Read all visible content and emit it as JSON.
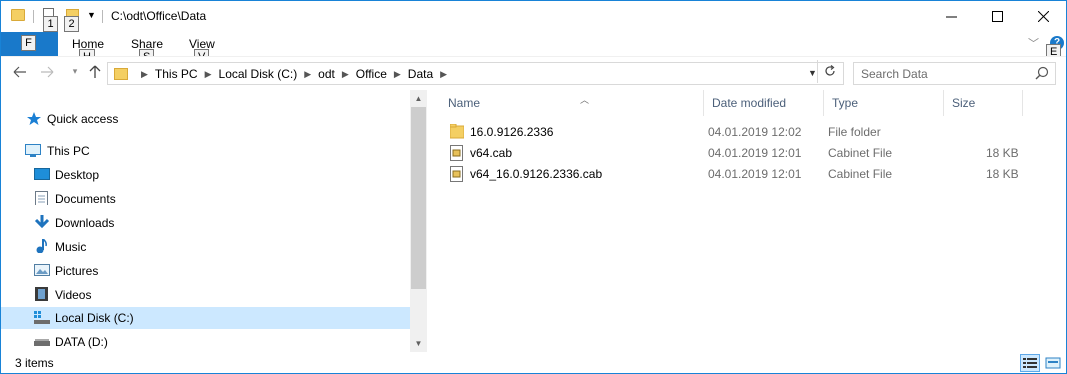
{
  "window": {
    "title": "C:\\odt\\Office\\Data",
    "keytips": {
      "qat1": "1",
      "qat2": "2",
      "file": "F",
      "home": "H",
      "share": "S",
      "view": "V",
      "help": "E"
    }
  },
  "ribbon": {
    "tabs": [
      "Home",
      "Share",
      "View"
    ],
    "help_glyph": "?"
  },
  "address": {
    "crumbs": [
      "This PC",
      "Local Disk (C:)",
      "odt",
      "Office",
      "Data"
    ]
  },
  "search": {
    "placeholder": "Search Data"
  },
  "navpane": {
    "items": [
      {
        "label": "Quick access",
        "icon": "star-icon"
      },
      {
        "label": "This PC",
        "icon": "computer-icon"
      },
      {
        "label": "Desktop",
        "icon": "desktop-icon"
      },
      {
        "label": "Documents",
        "icon": "documents-icon"
      },
      {
        "label": "Downloads",
        "icon": "downloads-icon"
      },
      {
        "label": "Music",
        "icon": "music-icon"
      },
      {
        "label": "Pictures",
        "icon": "pictures-icon"
      },
      {
        "label": "Videos",
        "icon": "videos-icon"
      },
      {
        "label": "Local Disk (C:)",
        "icon": "drive-icon",
        "selected": true
      },
      {
        "label": "DATA (D:)",
        "icon": "drive-icon"
      }
    ]
  },
  "columns": {
    "name": "Name",
    "date": "Date modified",
    "type": "Type",
    "size": "Size"
  },
  "files": [
    {
      "name": "16.0.9126.2336",
      "date": "04.01.2019 12:02",
      "type": "File folder",
      "size": "",
      "icon": "folder-icon"
    },
    {
      "name": "v64.cab",
      "date": "04.01.2019 12:01",
      "type": "Cabinet File",
      "size": "18 KB",
      "icon": "cabinet-file-icon"
    },
    {
      "name": "v64_16.0.9126.2336.cab",
      "date": "04.01.2019 12:01",
      "type": "Cabinet File",
      "size": "18 KB",
      "icon": "cabinet-file-icon"
    }
  ],
  "status": {
    "item_count": "3 items"
  },
  "colors": {
    "accent": "#1979ca",
    "selection": "#cce8ff",
    "folder": "#f4cf63"
  }
}
